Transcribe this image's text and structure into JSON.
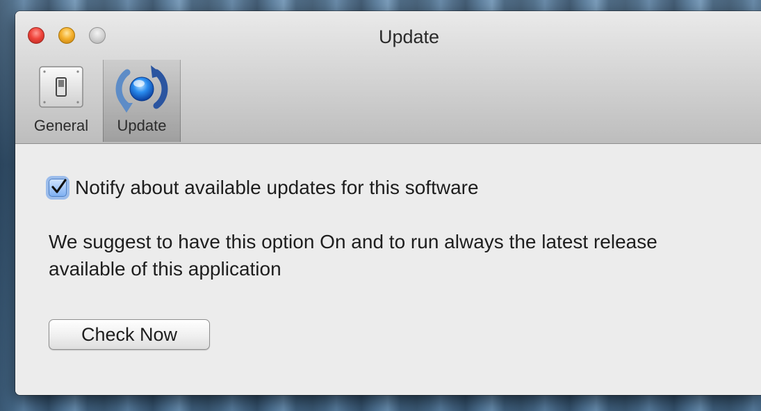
{
  "window": {
    "title": "Update"
  },
  "toolbar": {
    "items": [
      {
        "label": "General",
        "icon": "toggle-switch-icon"
      },
      {
        "label": "Update",
        "icon": "refresh-arrows-icon",
        "selected": true
      }
    ]
  },
  "settings": {
    "notify_label": "Notify about available updates for this software",
    "notify_checked": true,
    "description": "We suggest to have this option On and to run always the latest release available of this application",
    "check_button_label": "Check Now"
  },
  "colors": {
    "accent": "#4e7fc2",
    "close": "#f0463d",
    "minimize": "#f5b12e"
  }
}
